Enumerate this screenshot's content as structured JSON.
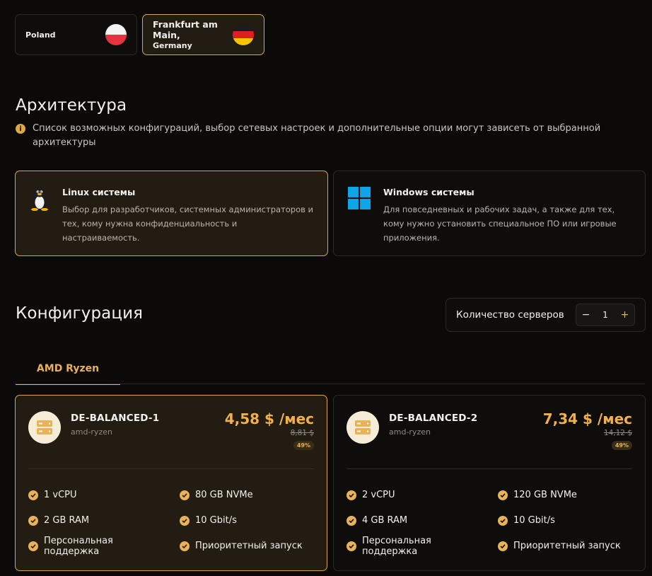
{
  "locations": [
    {
      "label_lines": [
        "Poland"
      ],
      "flag": "poland-flag",
      "selected": false
    },
    {
      "label_lines": [
        "Frankfurt am",
        "Main,",
        "Germany"
      ],
      "flag": "germany-flag",
      "selected": true
    }
  ],
  "architecture": {
    "title": "Архитектура",
    "info_icon": "info-icon",
    "info": "Список возможных конфигураций, выбор сетевых настроек и дополнительные опции могут зависеть от выбранной архитектуры",
    "options": [
      {
        "title": "Linux системы",
        "description": "Выбор для разработчиков, системных администраторов и тех, кому нужна конфиденциальность и настраиваемость.",
        "icon": "tux-icon",
        "selected": true
      },
      {
        "title": "Windows системы",
        "description": "Для повседневных и рабочих задач, а также для тех, кому нужно установить специальное ПО или игровые приложения.",
        "icon": "windows-icon",
        "selected": false
      }
    ]
  },
  "configuration": {
    "title": "Конфигурация",
    "server_count_label": "Количество серверов",
    "server_count": "1",
    "minus": "−",
    "plus": "+",
    "tabs": [
      "AMD Ryzen"
    ]
  },
  "plans": [
    {
      "name": "DE-BALANCED-1",
      "sub": "amd-ryzen",
      "price": "4,58 $ /мес",
      "old_price": "8,81 $",
      "discount": "49%",
      "features": [
        "1 vCPU",
        "80 GB NVMe",
        "2 GB RAM",
        "10 Gbit/s",
        "Персональная поддержка",
        "Приоритетный запуск"
      ],
      "selected": true
    },
    {
      "name": "DE-BALANCED-2",
      "sub": "amd-ryzen",
      "price": "7,34 $ /мес",
      "old_price": "14,12 $",
      "discount": "49%",
      "features": [
        "2 vCPU",
        "120 GB NVMe",
        "4 GB RAM",
        "10 Gbit/s",
        "Персональная поддержка",
        "Приоритетный запуск"
      ],
      "selected": false
    }
  ],
  "colors": {
    "accent": "#e9b158",
    "selected_border": "#d9a64f",
    "background": "#0b0a09"
  }
}
